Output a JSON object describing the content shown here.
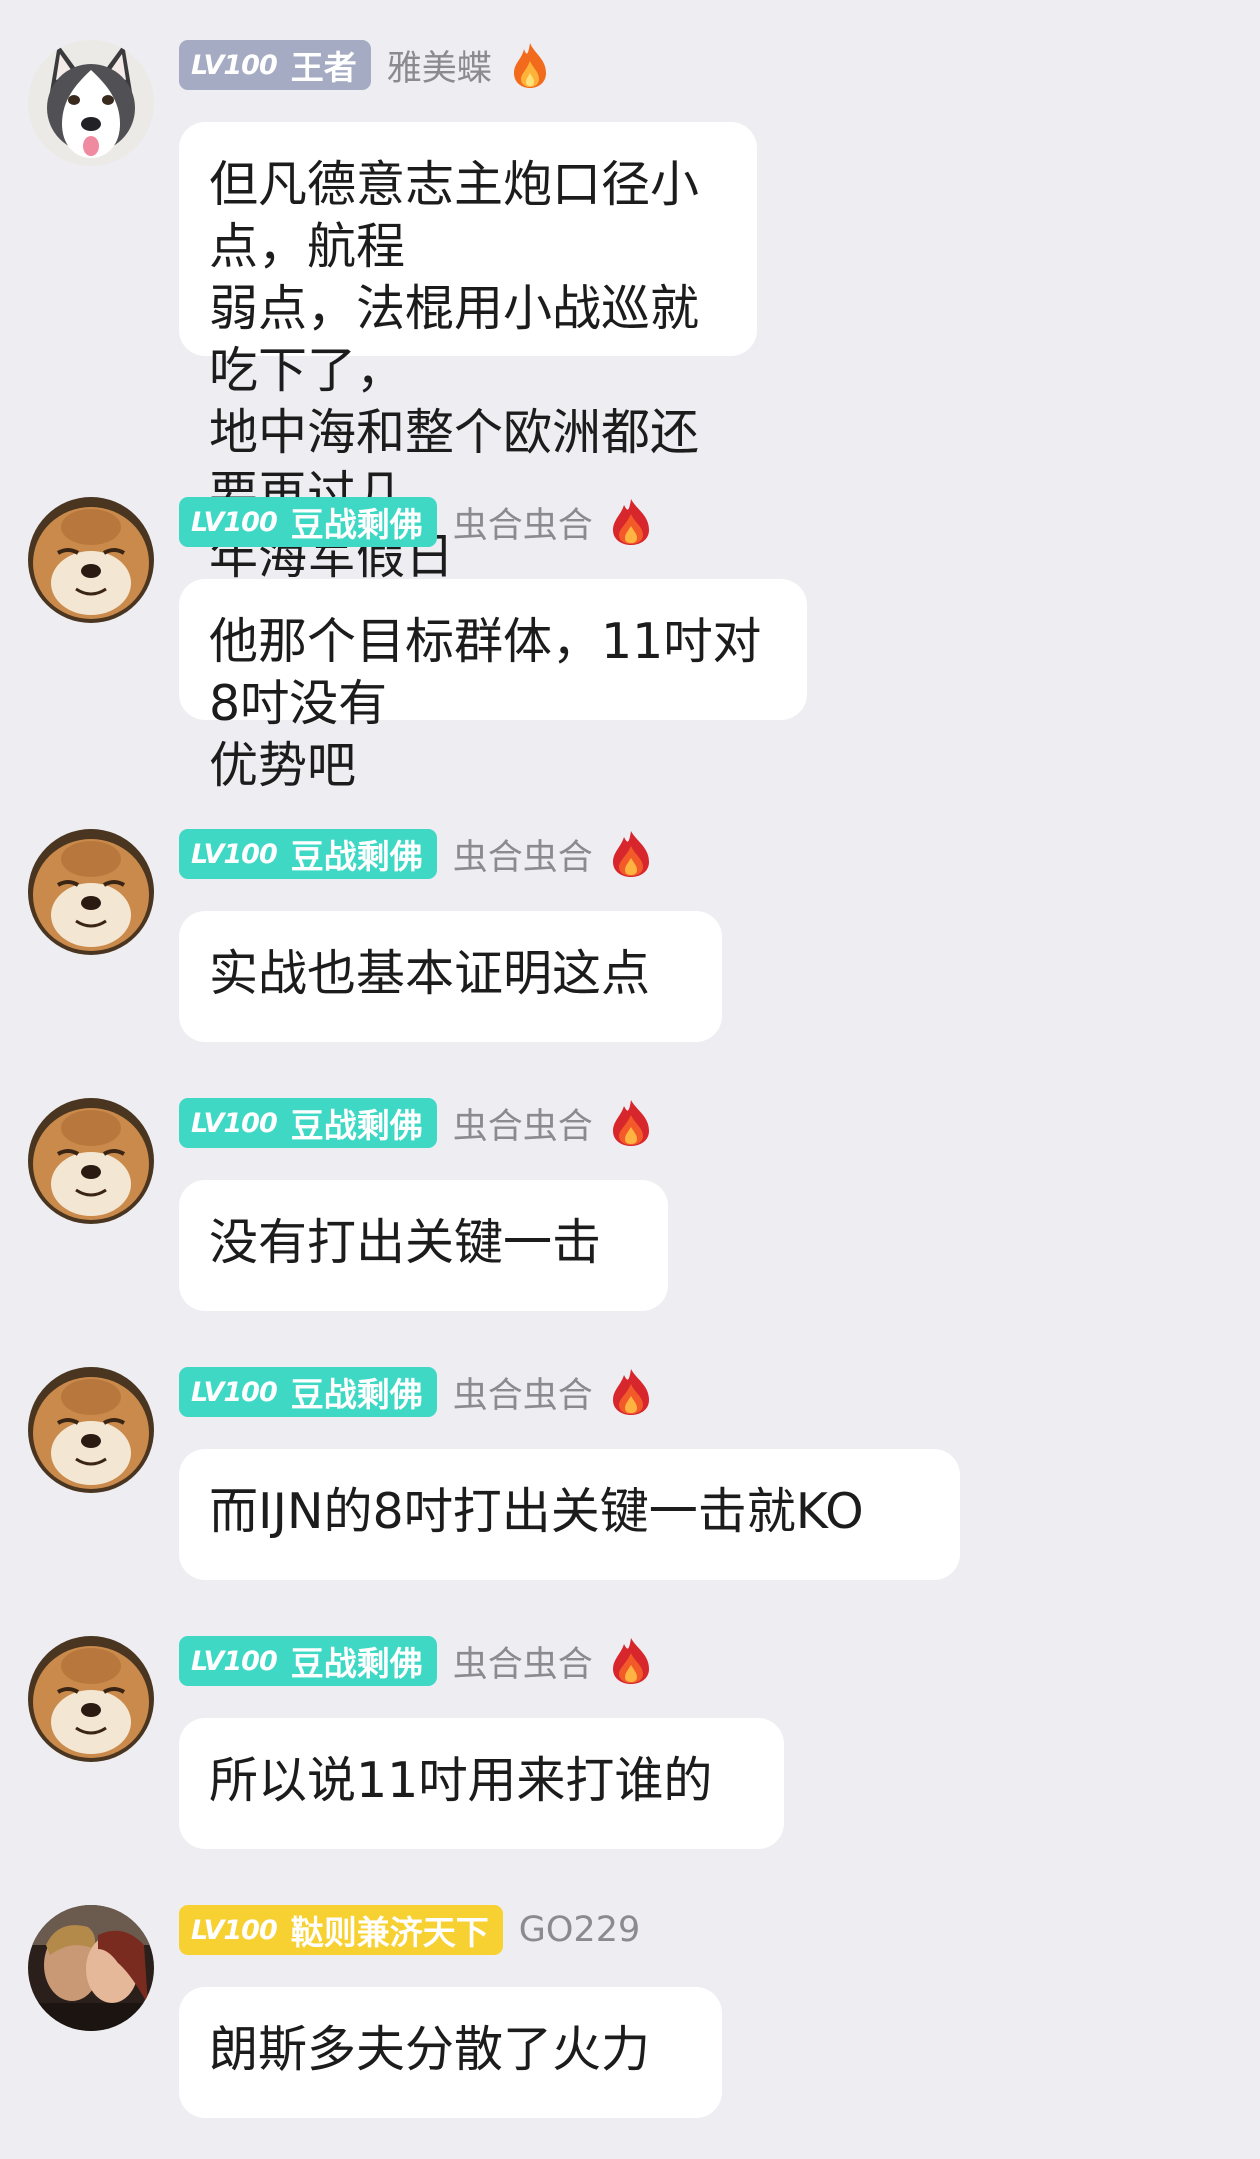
{
  "messages": [
    {
      "avatar": "husky-avatar",
      "level": "LV100",
      "title": "王者",
      "badge_color": "#a4abc2",
      "username": "雅美蝶",
      "flame": "orange-fire-icon",
      "text": "但凡德意志主炮口径小点，航程\n弱点，法棍用小战巡就吃下了，\n地中海和整个欧洲都还要再过几\n年海军假日"
    },
    {
      "avatar": "shiba-avatar",
      "level": "LV100",
      "title": "豆战剩佛",
      "badge_color": "#3ed8c5",
      "username": "虫合虫合",
      "flame": "red-fire-icon",
      "text": "他那个目标群体，11吋对8吋没有\n优势吧"
    },
    {
      "avatar": "shiba-avatar",
      "level": "LV100",
      "title": "豆战剩佛",
      "badge_color": "#3ed8c5",
      "username": "虫合虫合",
      "flame": "red-fire-icon",
      "text": "实战也基本证明这点"
    },
    {
      "avatar": "shiba-avatar",
      "level": "LV100",
      "title": "豆战剩佛",
      "badge_color": "#3ed8c5",
      "username": "虫合虫合",
      "flame": "red-fire-icon",
      "text": "没有打出关键一击"
    },
    {
      "avatar": "shiba-avatar",
      "level": "LV100",
      "title": "豆战剩佛",
      "badge_color": "#3ed8c5",
      "username": "虫合虫合",
      "flame": "red-fire-icon",
      "text": "而IJN的8吋打出关键一击就KO"
    },
    {
      "avatar": "shiba-avatar",
      "level": "LV100",
      "title": "豆战剩佛",
      "badge_color": "#3ed8c5",
      "username": "虫合虫合",
      "flame": "red-fire-icon",
      "text": "所以说11吋用来打谁的"
    },
    {
      "avatar": "movie-couple-avatar",
      "level": "LV100",
      "title": "鞑则兼济天下",
      "badge_color": "#f7d031",
      "username": "GO229",
      "flame": "",
      "text": "朗斯多夫分散了火力"
    }
  ]
}
